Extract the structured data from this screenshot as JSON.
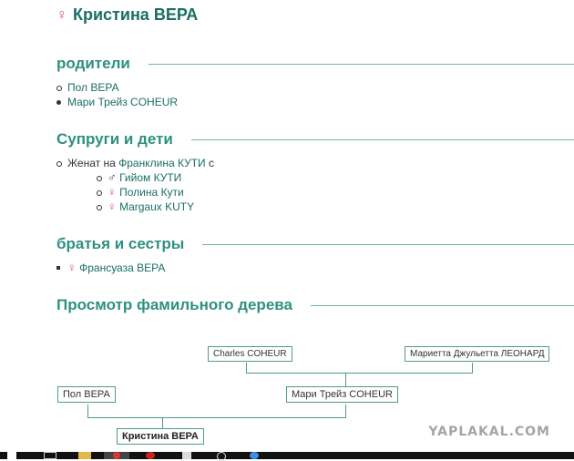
{
  "person": {
    "name": "Кристина ВЕРА",
    "gender_symbol": "♀"
  },
  "sections": {
    "parents": {
      "title": "родители",
      "items": [
        "Пол ВЕРА",
        "Мари Трейз COHEUR"
      ]
    },
    "spouses": {
      "title": "Супруги и дети",
      "married_prefix": "Женат на",
      "spouse": "Франклина КУТИ",
      "married_suffix": "с",
      "children": [
        {
          "symbol": "♂",
          "name": "Гийом КУТИ"
        },
        {
          "symbol": "♀",
          "name": "Полина Кути"
        },
        {
          "symbol": "♀",
          "name": "Margaux KUTY"
        }
      ]
    },
    "siblings": {
      "title": "братья и сестры",
      "items": [
        {
          "symbol": "♀",
          "name": "Франсуаза ВЕРА"
        }
      ]
    },
    "tree": {
      "title": "Просмотр фамильного дерева",
      "nodes": {
        "gf": "Charles COHEUR",
        "gm": "Мариетта Джульетта ЛЕОНАРД",
        "father": "Пол ВЕРА",
        "mother": "Мари Трейз COHEUR",
        "self": "Кристина ВЕРА"
      }
    }
  },
  "watermark": "YAPLAKAL.COM",
  "colors": {
    "accent": "#2e9080",
    "link": "#1a6e63",
    "female": "#d64f8a"
  }
}
